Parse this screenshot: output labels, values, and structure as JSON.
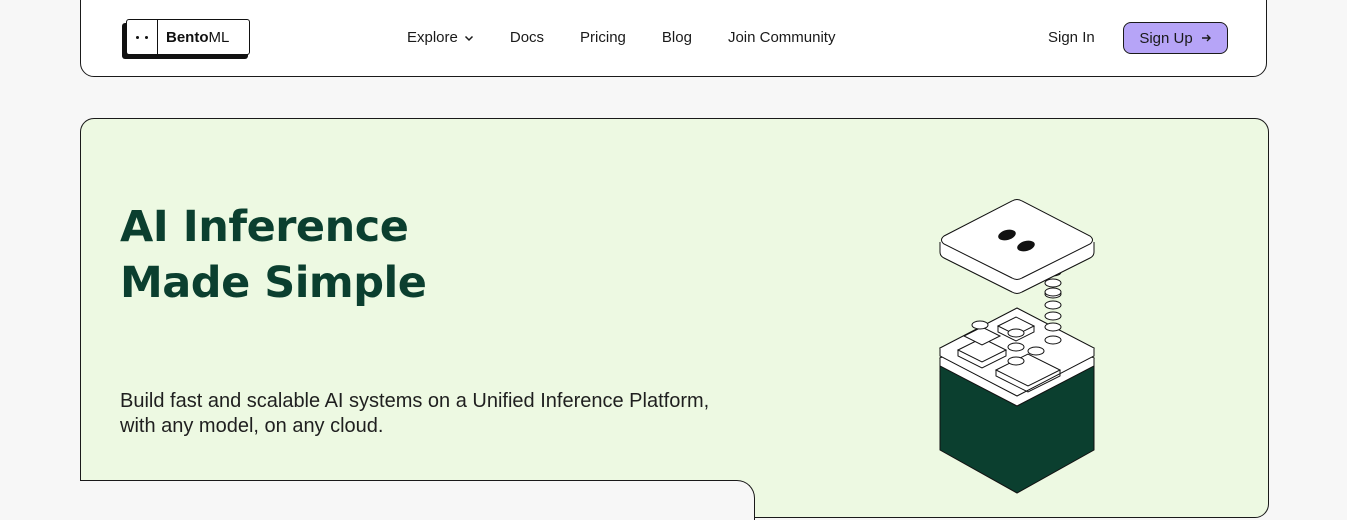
{
  "brand": {
    "name_bold": "Bento",
    "name_regular": "ML"
  },
  "nav": {
    "links": [
      {
        "label": "Explore",
        "has_dropdown": true
      },
      {
        "label": "Docs"
      },
      {
        "label": "Pricing"
      },
      {
        "label": "Blog"
      },
      {
        "label": "Join Community"
      }
    ],
    "sign_in": "Sign In",
    "sign_up": "Sign Up",
    "sign_up_icon": "arrow-right-icon"
  },
  "hero": {
    "title_line1": "AI Inference",
    "title_line2": "Made Simple",
    "subtitle_line1": "Build fast and scalable AI systems on a Unified Inference Platform,",
    "subtitle_line2": "with any model, on any cloud.",
    "illustration": "bento-box-icon"
  },
  "colors": {
    "accent": "#b6a4f7",
    "hero_bg": "#edf9e2",
    "brand_green": "#0b3f2f",
    "page_bg": "#f7f7f7"
  }
}
